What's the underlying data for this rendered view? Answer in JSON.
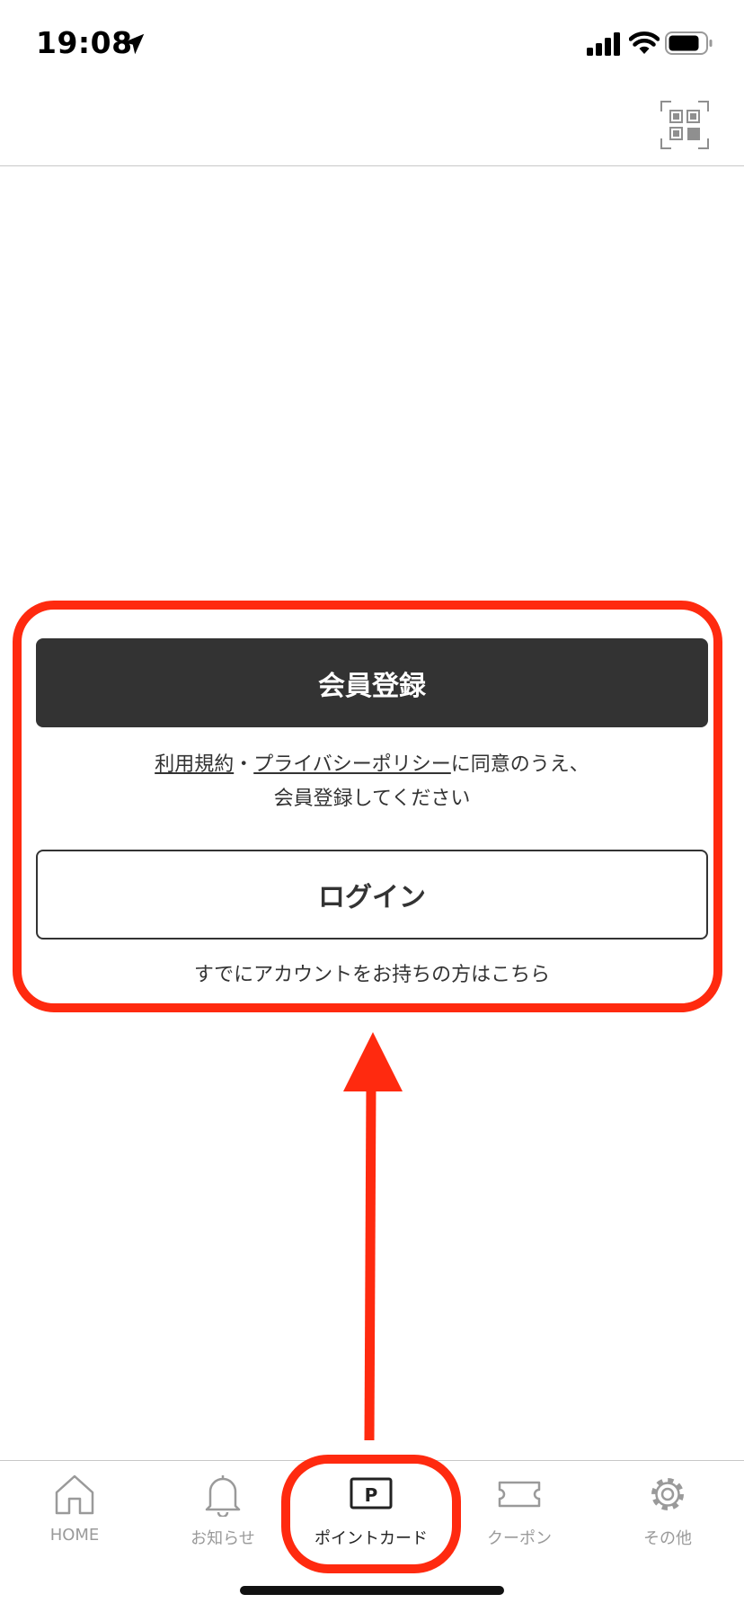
{
  "status_bar": {
    "time": "19:08"
  },
  "header": {
    "qr_icon": "qr-code-icon"
  },
  "membership": {
    "register_label": "会員登録",
    "terms_link": "利用規約",
    "separator": "・",
    "privacy_link": "プライバシーポリシー",
    "terms_suffix": "に同意のうえ、",
    "terms_line2": "会員登録してください",
    "login_label": "ログイン",
    "login_hint": "すでにアカウントをお持ちの方はこちら"
  },
  "tabs": [
    {
      "label": "HOME",
      "icon": "home-icon",
      "active": false
    },
    {
      "label": "お知らせ",
      "icon": "bell-icon",
      "active": false
    },
    {
      "label": "ポイントカード",
      "icon": "point-card-icon",
      "active": true
    },
    {
      "label": "クーポン",
      "icon": "ticket-icon",
      "active": false
    },
    {
      "label": "その他",
      "icon": "gear-icon",
      "active": false
    }
  ],
  "point_card_glyph": "P",
  "colors": {
    "highlight": "#ff2a0f",
    "primary_button": "#333333",
    "inactive_tab": "#9a9a9a",
    "active_tab": "#222222"
  }
}
